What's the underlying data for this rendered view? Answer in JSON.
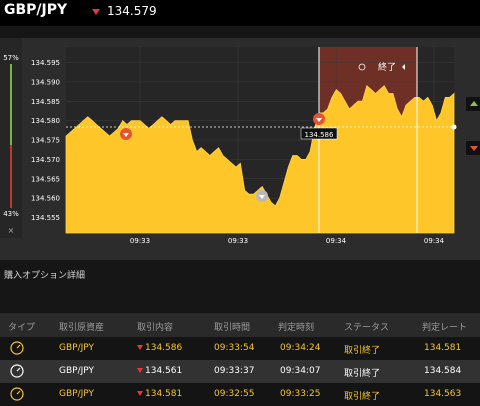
{
  "header": {
    "pair": "GBP/JPY",
    "price": "134.579",
    "direction": "down"
  },
  "chart": {
    "high_pct": "57%",
    "low_pct": "43%",
    "close_symbol": "×",
    "current_price_label": "134.586",
    "end_button_label": "終了",
    "colors": {
      "area": "#ffc629",
      "down": "#e8532f",
      "up": "#8bc34a",
      "end_zone": "#6e2f26"
    }
  },
  "chart_data": {
    "type": "area",
    "yticks": [
      "134.595",
      "134.590",
      "134.585",
      "134.580",
      "134.575",
      "134.570",
      "134.565",
      "134.560",
      "134.555"
    ],
    "xticks": [
      "09:33",
      "09:33",
      "09:34",
      "09:34"
    ],
    "ylim": [
      134.551,
      134.599
    ],
    "series": [
      {
        "values": [
          134.576,
          134.577,
          134.578,
          134.579,
          134.58,
          134.581,
          134.58,
          134.579,
          134.578,
          134.577,
          134.576,
          134.577,
          134.578,
          134.58,
          134.579,
          134.58,
          134.58,
          134.58,
          134.579,
          134.578,
          134.579,
          134.58,
          134.581,
          134.58,
          134.579,
          134.58,
          134.58,
          134.58,
          134.58,
          134.575,
          134.572,
          134.573,
          134.572,
          134.571,
          134.572,
          134.573,
          134.571,
          134.57,
          134.569,
          134.568,
          134.569,
          134.562,
          134.561,
          134.561,
          134.562,
          134.563,
          134.561,
          134.559,
          134.558,
          134.56,
          134.564,
          134.568,
          134.571,
          134.571,
          134.57,
          134.57,
          134.572,
          134.578,
          134.582,
          134.582,
          134.583,
          134.586,
          134.588,
          134.587,
          134.585,
          134.583,
          134.584,
          134.585,
          134.585,
          134.589,
          134.588,
          134.587,
          134.588,
          134.589,
          134.587,
          134.587,
          134.583,
          134.581,
          134.584,
          134.585,
          134.586,
          134.586,
          134.585,
          134.586,
          134.584,
          134.58,
          134.582,
          134.586,
          134.586,
          134.587
        ]
      }
    ]
  },
  "section": {
    "purchase_details": "購入オプション詳細"
  },
  "table": {
    "headers": [
      "タイプ",
      "取引原資産",
      "取引内容",
      "取引時間",
      "判定時刻",
      "ステータス",
      "判定レート"
    ],
    "rows": [
      {
        "asset": "GBP/JPY",
        "content": "134.586",
        "time": "09:33:54",
        "judge_time": "09:34:24",
        "status": "取引終了",
        "rate": "134.581"
      },
      {
        "asset": "GBP/JPY",
        "content": "134.561",
        "time": "09:33:37",
        "judge_time": "09:34:07",
        "status": "取引終了",
        "rate": "134.584"
      },
      {
        "asset": "GBP/JPY",
        "content": "134.581",
        "time": "09:32:55",
        "judge_time": "09:33:25",
        "status": "取引終了",
        "rate": "134.563"
      }
    ]
  }
}
